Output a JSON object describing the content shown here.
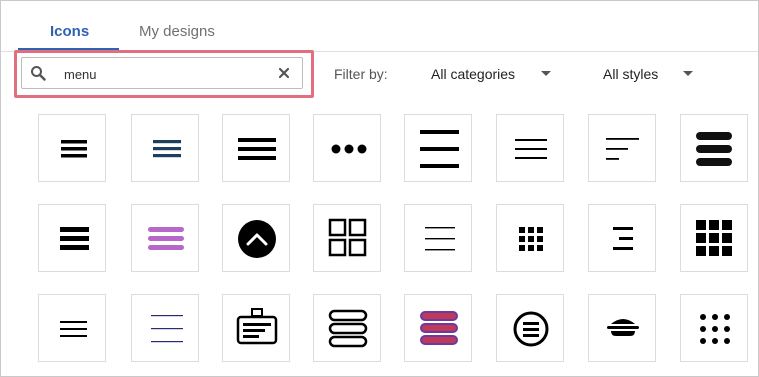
{
  "tabs": [
    {
      "label": "Icons",
      "active": true
    },
    {
      "label": "My designs",
      "active": false
    }
  ],
  "search": {
    "value": "menu",
    "icon": "search-icon",
    "clear_icon": "close-icon"
  },
  "filters": {
    "label": "Filter by:",
    "categories": "All categories",
    "styles": "All styles"
  },
  "colors": {
    "accent": "#2f62b3",
    "highlight": "#e0707f",
    "navy": "#1c3f5e",
    "purple": "#b667c7",
    "gradient_red": "#c0385a",
    "gradient_purple": "#6a3aa2"
  },
  "icons": {
    "row1": [
      "hamburger-menu-icon",
      "navy-hamburger-menu-icon",
      "hamburger-menu-wide-icon",
      "more-horizontal-dots-icon",
      "hamburger-menu-large-icon",
      "hamburger-menu-thin-icon",
      "menu-left-align-icon",
      "hamburger-menu-rounded-icon"
    ],
    "row2": [
      "stacked-list-icon",
      "purple-hamburger-menu-icon",
      "chevron-up-circle-icon",
      "grid-four-squares-icon",
      "hamburger-menu-lines-icon",
      "grid-dots-icon",
      "menu-right-align-icon",
      "grid-nine-squares-icon"
    ],
    "row3": [
      "hamburger-menu-small-icon",
      "hamburger-menu-blue-thin-icon",
      "menu-card-icon",
      "burger-outline-icon",
      "gradient-burger-icon",
      "menu-circle-icon",
      "hamburger-burger-icon",
      "dots-grid-icon"
    ]
  }
}
